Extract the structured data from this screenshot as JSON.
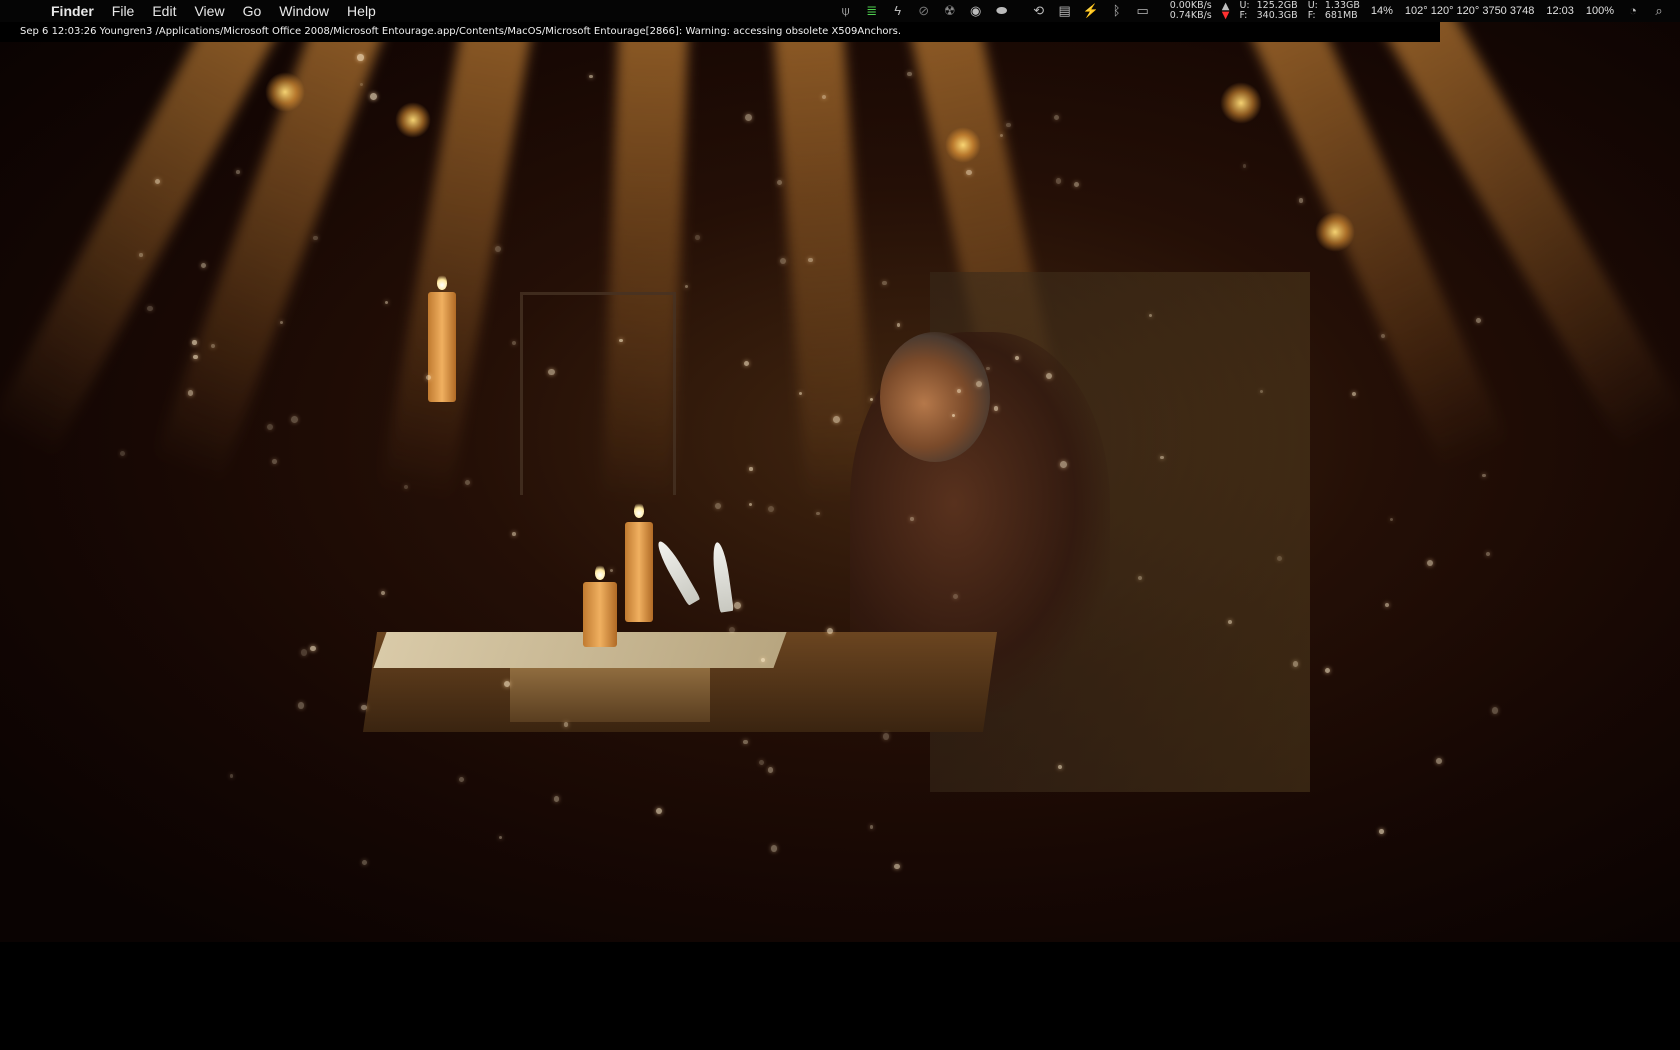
{
  "menubar": {
    "apple_icon": "",
    "items": [
      "Finder",
      "File",
      "Edit",
      "View",
      "Go",
      "Window",
      "Help"
    ]
  },
  "status": {
    "net_up": "0.00KB/s",
    "net_down": "0.74KB/s",
    "disk1_u": "U:",
    "disk1_f": "F:",
    "disk1_used": "125.2GB",
    "disk1_free": "340.3GB",
    "mem_u": "U:",
    "mem_f": "F:",
    "mem_used": "1.33GB",
    "mem_free": "681MB",
    "cpu": "14%",
    "temps": "102° 120° 120° 3750 3748",
    "clock": "12:03",
    "battery": "100%",
    "icon_names": [
      "antenna-icon",
      "activity-bars-icon",
      "bolt-icon",
      "circle-slash-icon",
      "radiation-icon",
      "disc-icon",
      "drive-icon",
      "time-machine-icon",
      "clipboard-icon",
      "lightning-icon",
      "bluetooth-icon",
      "display-icon",
      "wifi-icon",
      "spotlight-icon"
    ]
  },
  "console": {
    "message": "Sep 6 12:03:26 Youngren3 /Applications/Microsoft Office 2008/Microsoft Entourage.app/Contents/MacOS/Microsoft Entourage[2866]: Warning: accessing obsolete X509Anchors."
  },
  "colors": {
    "menubar_bg": "#050505",
    "menu_text": "#e8e8e8",
    "download_arrow": "#ff3030",
    "beam": "#ffaa46"
  }
}
